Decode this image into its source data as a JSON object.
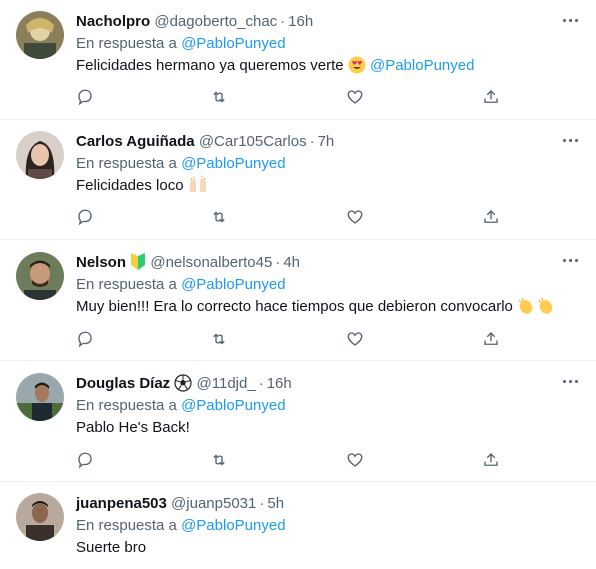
{
  "replying_label": "En respuesta a",
  "tweets": [
    {
      "name": "Nacholpro",
      "handle": "@dagoberto_chac",
      "time": "16h",
      "reply_to": "@PabloPunyed",
      "text": "Felicidades hermano ya queremos verte",
      "text_emoji": "heart-eyes-emoji",
      "text_mention": "@PabloPunyed"
    },
    {
      "name": "Carlos Aguiñada",
      "handle": "@Car105Carlos",
      "time": "7h",
      "reply_to": "@PabloPunyed",
      "text": "Felicidades loco",
      "text_emoji": "raised-hands-emoji"
    },
    {
      "name": "Nelson",
      "name_emoji": "beginner-badge-emoji",
      "handle": "@nelsonalberto45",
      "time": "4h",
      "reply_to": "@PabloPunyed",
      "text": "Muy bien!!! Era lo correcto hace tiempos que debieron convocarlo",
      "text_emoji": "clapping-hands-emoji"
    },
    {
      "name": "Douglas Díaz",
      "name_emoji": "soccer-ball-emoji",
      "handle": "@11djd_",
      "time": "16h",
      "reply_to": "@PabloPunyed",
      "text": "Pablo He's Back!"
    },
    {
      "name": "juanpena503",
      "handle": "@juanp5031",
      "time": "5h",
      "reply_to": "@PabloPunyed",
      "text": "Suerte bro"
    }
  ],
  "icons": {
    "more": "more-horizontal-icon",
    "reply": "reply-icon",
    "retweet": "retweet-icon",
    "like": "like-heart-icon",
    "share": "share-icon"
  },
  "colors": {
    "link": "#1d9bf0",
    "secondary": "#536471",
    "primary": "#0f1419",
    "divider": "#eff3f4"
  }
}
